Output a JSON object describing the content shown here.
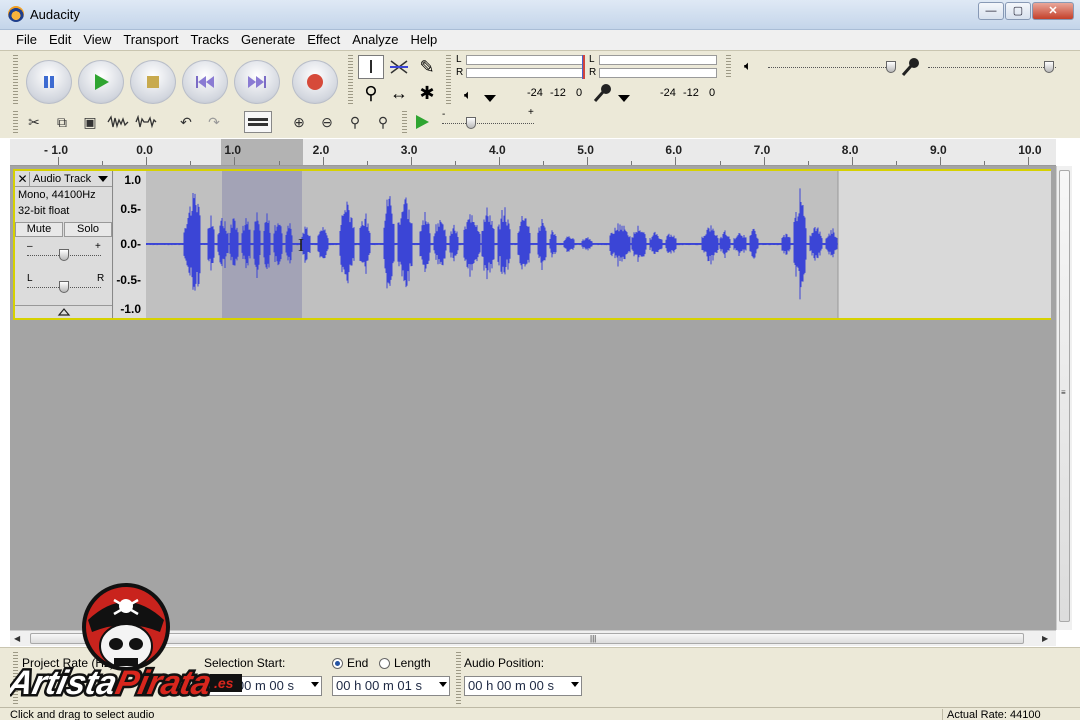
{
  "window": {
    "title": "Audacity",
    "controls": [
      "—",
      "▢",
      "✕"
    ]
  },
  "menu": [
    "File",
    "Edit",
    "View",
    "Transport",
    "Tracks",
    "Generate",
    "Effect",
    "Analyze",
    "Help"
  ],
  "meters": {
    "left_label": "L",
    "right_label": "R",
    "playback_scale": [
      "-24",
      "-12",
      "0"
    ],
    "record_scale": [
      "-24",
      "-12",
      "0"
    ]
  },
  "ruler": {
    "labels": [
      "- 1.0",
      "0.0",
      "1.0",
      "2.0",
      "3.0",
      "4.0",
      "5.0",
      "6.0",
      "7.0",
      "8.0",
      "9.0",
      "10.0"
    ]
  },
  "track": {
    "name": "Audio Track",
    "rate_info": "Mono, 44100Hz",
    "format_info": "32-bit float",
    "mute_label": "Mute",
    "solo_label": "Solo",
    "gain_minus": "–",
    "gain_plus": "+",
    "pan_left": "L",
    "pan_right": "R",
    "scale_labels": [
      "1.0",
      "0.5-",
      "0.0-",
      "-0.5-",
      "-1.0"
    ],
    "wave_color": "#3b45d6"
  },
  "selection_toolbar": {
    "project_rate_label": "Project Rate (Hz):",
    "selection_start_label": "Selection Start:",
    "end_label": "End",
    "length_label": "Length",
    "audio_position_label": "Audio Position:",
    "start_value": "00 h 00 m 00 s",
    "end_value": "00 h 00 m 01 s",
    "position_value": "00 h 00 m 00 s"
  },
  "status": {
    "left": "Click and drag to select audio",
    "right": "Actual Rate: 44100"
  },
  "watermark": {
    "brand": "ArtistaPirata",
    "suffix": ".es"
  }
}
